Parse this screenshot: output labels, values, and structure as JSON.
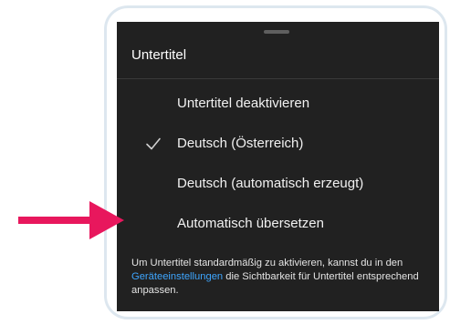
{
  "sheet": {
    "title": "Untertitel",
    "options": [
      {
        "label": "Untertitel deaktivieren",
        "selected": false
      },
      {
        "label": "Deutsch (Österreich)",
        "selected": true
      },
      {
        "label": "Deutsch (automatisch erzeugt)",
        "selected": false
      },
      {
        "label": "Automatisch übersetzen",
        "selected": false
      }
    ],
    "footer": {
      "text_before_link": "Um Untertitel standardmäßig zu aktivieren, kannst du in den ",
      "link_text": "Geräteeinstellungen",
      "text_after_link": " die Sichtbarkeit für Untertitel entsprechend anpassen."
    }
  },
  "colors": {
    "sheet_background": "#212121",
    "link": "#3ea6ff",
    "arrow": "#e8175d",
    "frame": "#dde7ef"
  },
  "icons": {
    "selected_marker": "checkmark-icon",
    "annotation": "pointer-arrow"
  }
}
